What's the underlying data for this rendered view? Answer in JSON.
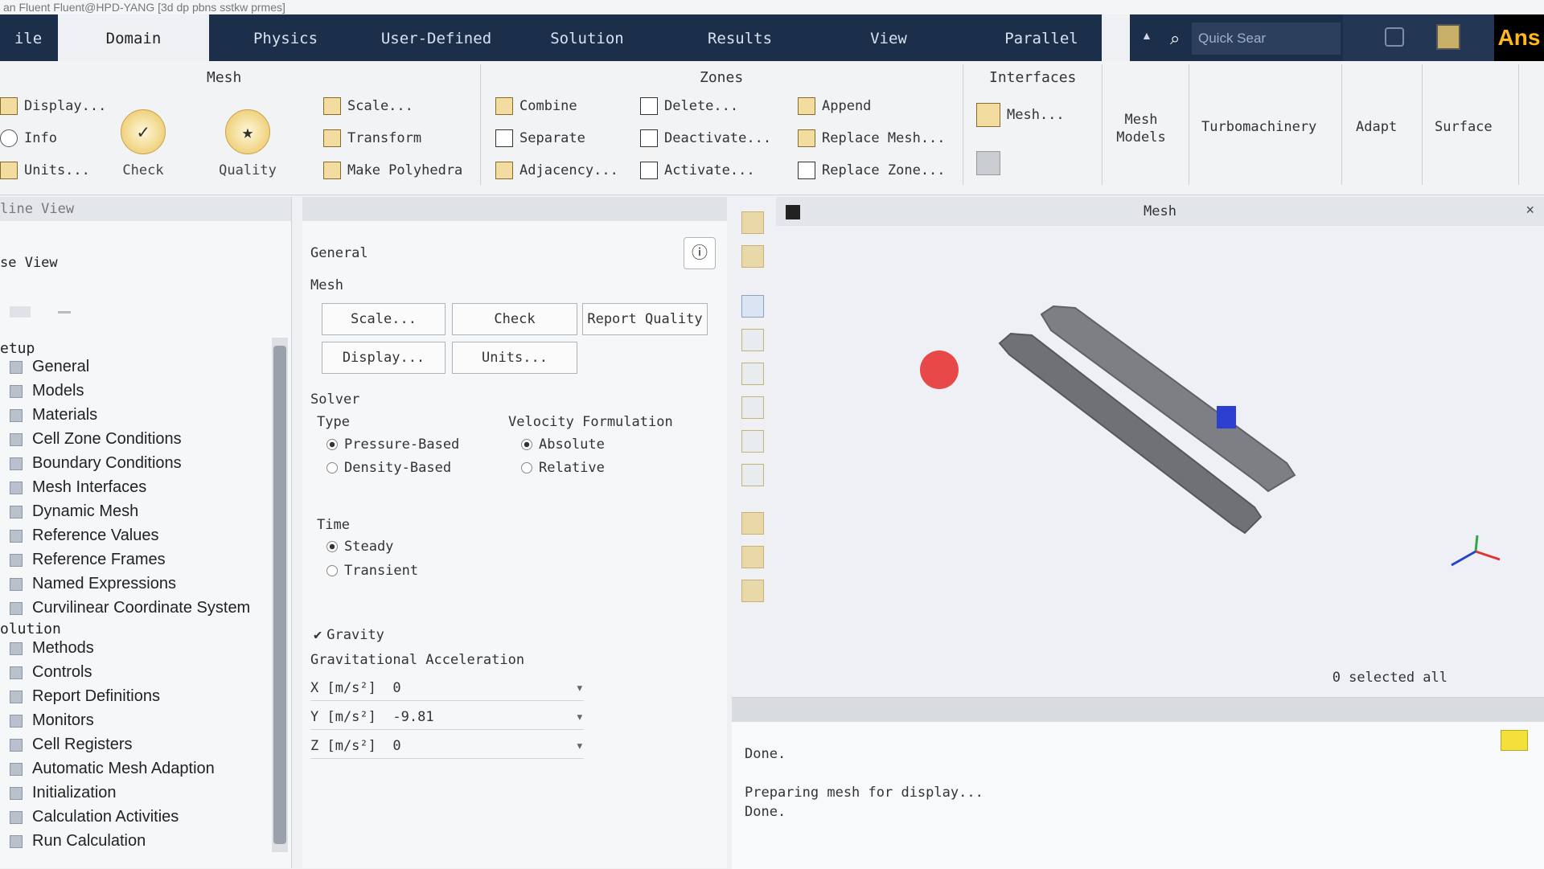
{
  "window": {
    "title": "an Fluent Fluent@HPD-YANG [3d dp pbns sstkw prmes]"
  },
  "menu": {
    "tabs": [
      "ile",
      "Domain",
      "Physics",
      "User-Defined",
      "Solution",
      "Results",
      "View",
      "Parallel"
    ],
    "active_tab": "Domain",
    "search_placeholder": "Quick Sear",
    "logo": "Ans"
  },
  "ribbon": {
    "mesh_group": {
      "title": "Mesh",
      "items": [
        "Display...",
        "Info",
        "Units..."
      ],
      "check": "Check",
      "quality": "Quality",
      "scale": "Scale...",
      "transform": "Transform",
      "make_polyhedra": "Make Polyhedra"
    },
    "zones_group": {
      "title": "Zones",
      "col1": [
        "Combine",
        "Separate",
        "Adjacency..."
      ],
      "col2": [
        "Delete...",
        "Deactivate...",
        "Activate..."
      ],
      "col3": [
        "Append",
        "Replace Mesh...",
        "Replace Zone..."
      ]
    },
    "interfaces_group": {
      "title": "Interfaces",
      "mesh": "Mesh..."
    },
    "mesh_models": "Mesh\nModels",
    "turbomachinery": "Turbomachinery",
    "adapt": "Adapt",
    "surface": "Surface"
  },
  "tree": {
    "header": "line View",
    "sub_header": "se View",
    "setup_label": "etup",
    "setup_items": [
      "General",
      "Models",
      "Materials",
      "Cell Zone Conditions",
      "Boundary Conditions",
      "Mesh Interfaces",
      "Dynamic Mesh",
      "Reference Values",
      "Reference Frames",
      "Named Expressions",
      "Curvilinear Coordinate System"
    ],
    "solution_label": "olution",
    "solution_items": [
      "Methods",
      "Controls",
      "Report Definitions",
      "Monitors",
      "Cell Registers",
      "Automatic Mesh Adaption",
      "Initialization",
      "Calculation Activities",
      "Run Calculation"
    ]
  },
  "task": {
    "heading": "General",
    "mesh_label": "Mesh",
    "buttons": {
      "scale": "Scale...",
      "check": "Check",
      "report_quality": "Report Quality",
      "display": "Display...",
      "units": "Units..."
    },
    "solver_label": "Solver",
    "type_label": "Type",
    "type_options": [
      "Pressure-Based",
      "Density-Based"
    ],
    "velocity_label": "Velocity Formulation",
    "velocity_options": [
      "Absolute",
      "Relative"
    ],
    "time_label": "Time",
    "time_options": [
      "Steady",
      "Transient"
    ],
    "gravity_label": "Gravity",
    "grav_accel_label": "Gravitational Acceleration",
    "grav": [
      {
        "label": "X [m/s²]",
        "value": "0"
      },
      {
        "label": "Y [m/s²]",
        "value": "-9.81"
      },
      {
        "label": "Z [m/s²]",
        "value": "0"
      }
    ]
  },
  "graphics": {
    "title": "Mesh",
    "status": "0 selected all"
  },
  "console": {
    "lines": [
      "Done.",
      "Preparing mesh for display...",
      "Done."
    ]
  },
  "colors": {
    "menubar": "#1b2e4a",
    "accent": "#ffb71b",
    "red_sphere": "#e94848",
    "blue_marker": "#2c3fd0"
  }
}
